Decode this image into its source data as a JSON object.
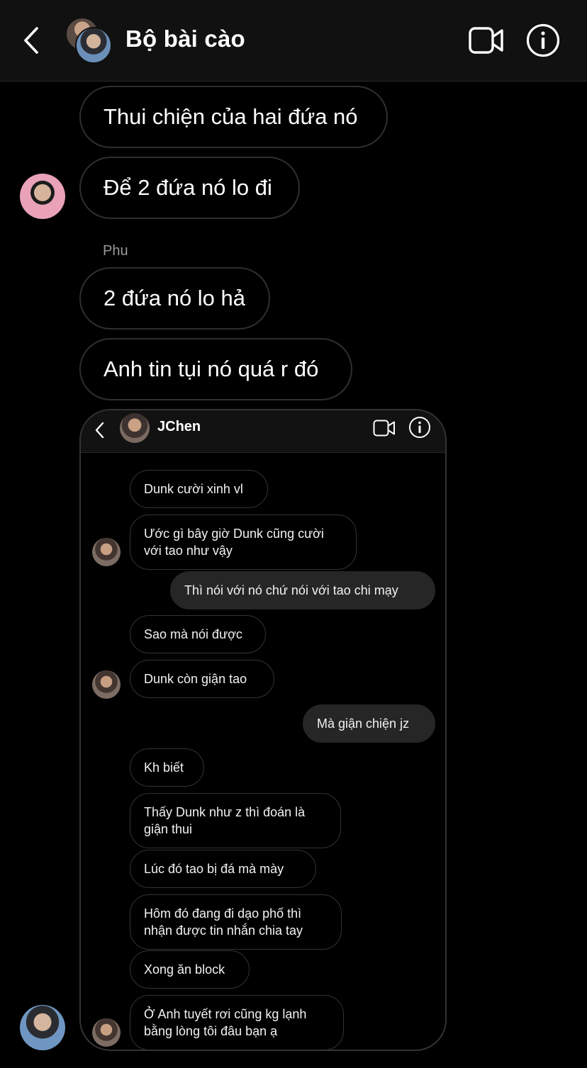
{
  "header": {
    "title": "Bộ bài cào",
    "back_icon": "chevron-left-icon",
    "video_icon": "video-camera-icon",
    "info_icon": "info-icon"
  },
  "messages": [
    {
      "text": "Thui chiện của hai đứa nó"
    },
    {
      "text": "Để 2 đứa nó lo đi"
    },
    {
      "sender": "Phu"
    },
    {
      "text": "2 đứa nó lo hả"
    },
    {
      "text": "Anh tin tụi nó quá r đó"
    }
  ],
  "shared_screenshot": {
    "title": "JChen",
    "messages": [
      {
        "text": "Dunk cười xinh vl",
        "own": false
      },
      {
        "text": "Ước gì bây giờ Dunk cũng cười với tao như vậy",
        "own": false
      },
      {
        "text": "Thì nói với nó chứ nói với tao chi mạy",
        "own": true
      },
      {
        "text": "Sao mà nói được",
        "own": false
      },
      {
        "text": "Dunk còn giận tao",
        "own": false
      },
      {
        "text": "Mà giận chiện jz",
        "own": true
      },
      {
        "text": "Kh biết",
        "own": false
      },
      {
        "text": "Thấy Dunk như z thì đoán là giận thui",
        "own": false
      },
      {
        "text": "Lúc đó tao bị đá mà mày",
        "own": false
      },
      {
        "text": "Hôm đó đang đi dạo phố thì nhận được tin nhắn chia tay",
        "own": false
      },
      {
        "text": "Xong ăn block",
        "own": false
      },
      {
        "text": "Ở Anh tuyết rơi cũng kg lạnh bằng lòng tôi đâu bạn ạ",
        "own": false
      }
    ]
  },
  "colors": {
    "background": "#000000",
    "header": "#111111",
    "bubble_border": "#2f2f2f",
    "own_bubble": "#262626",
    "muted_text": "#9a9a9a"
  }
}
